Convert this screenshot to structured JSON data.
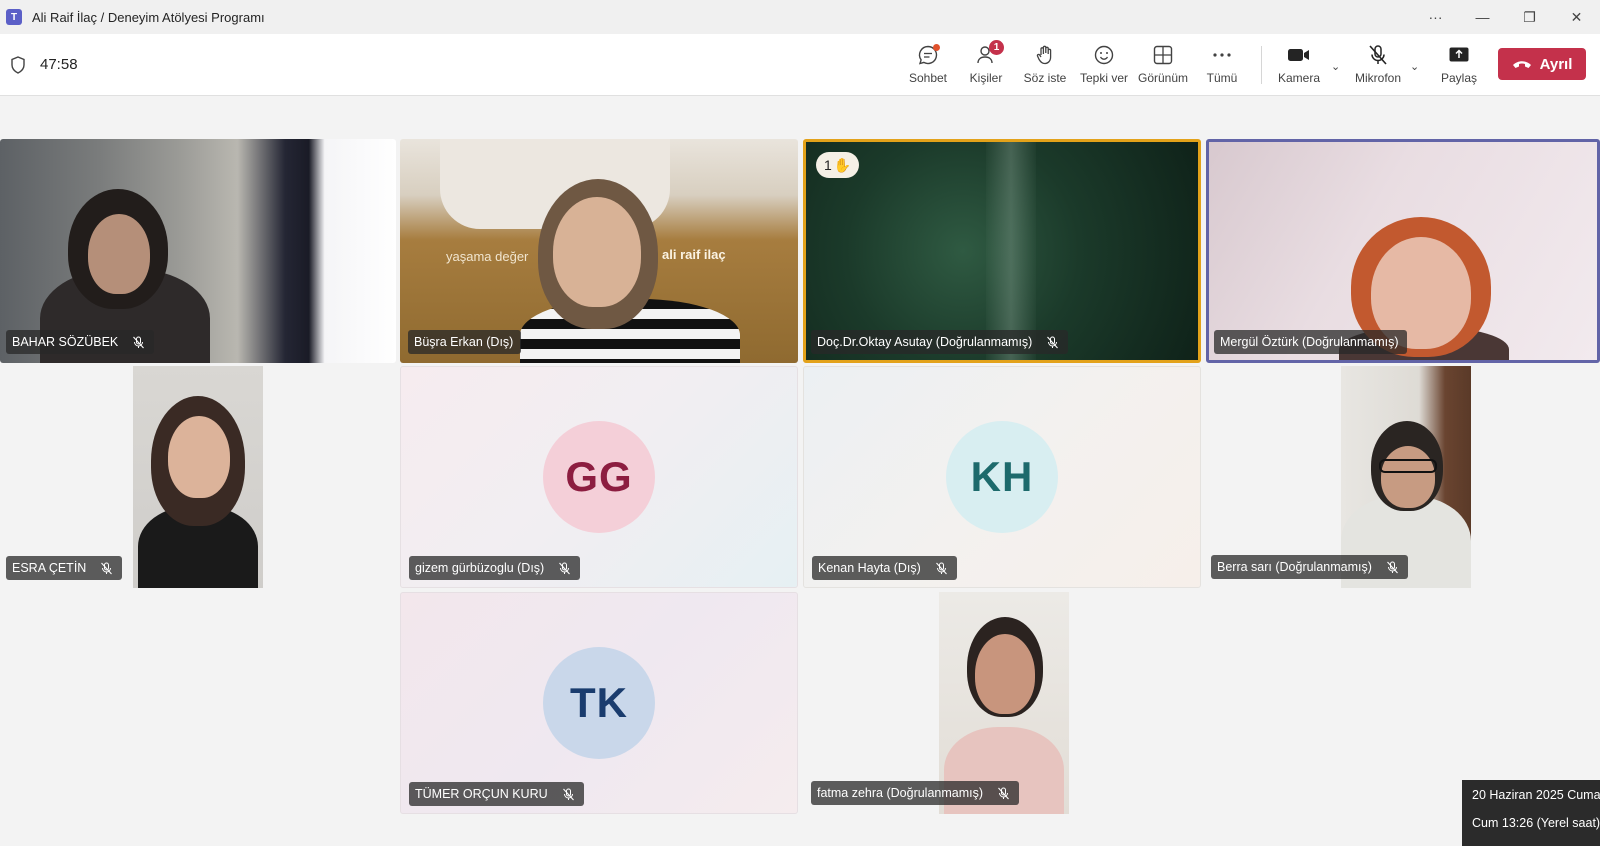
{
  "window": {
    "title": "Ali Raif İlaç / Deneyim Atölyesi Programı",
    "logo": "T"
  },
  "toolbar": {
    "timer": "47:58",
    "buttons": {
      "chat": "Sohbet",
      "people": "Kişiler",
      "people_badge": "1",
      "raise_hand": "Söz iste",
      "react": "Tepki ver",
      "view": "Görünüm",
      "more": "Tümü",
      "camera": "Kamera",
      "mic": "Mikrofon",
      "share": "Paylaş"
    },
    "leave": "Ayrıl"
  },
  "participants": {
    "bahar": {
      "name": "BAHAR SÖZÜBEK"
    },
    "busra": {
      "name": "Büşra Erkan (Dış)",
      "bg_text_left": "yaşama değer",
      "bg_text_right": "ali raif ilaç"
    },
    "oktay": {
      "name": "Doç.Dr.Oktay Asutay (Doğrulanmamış)",
      "hand_count": "1",
      "border_color": "#e3a21a"
    },
    "mergul": {
      "name": "Mergül Öztürk (Doğrulanmamış)",
      "border_color": "#6264a7"
    },
    "esra": {
      "name": "ESRA ÇETİN"
    },
    "gizem": {
      "name": "gizem gürbüzoglu (Dış)",
      "initials": "GG"
    },
    "kenan": {
      "name": "Kenan Hayta (Dış)",
      "initials": "KH"
    },
    "berra": {
      "name": "Berra sarı (Doğrulanmamış)"
    },
    "tumer": {
      "name": "TÜMER ORÇUN KURU",
      "initials": "TK"
    },
    "fatma": {
      "name": "fatma zehra (Doğrulanmamış)"
    }
  },
  "taskbar_popup": {
    "date": "20 Haziran 2025 Cuma",
    "time": "Cum 13:26 (Yerel saat)"
  },
  "colors": {
    "leave": "#c4314b",
    "accent": "#5b5fc7"
  }
}
